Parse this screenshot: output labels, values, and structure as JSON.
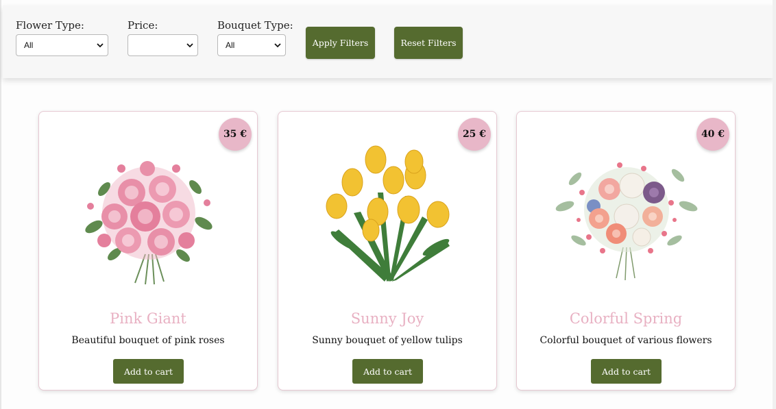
{
  "filters": {
    "flower_type": {
      "label": "Flower Type:",
      "selected": "All"
    },
    "price": {
      "label": "Price:",
      "selected": ""
    },
    "bouquet_type": {
      "label": "Bouquet Type:",
      "selected": "All"
    },
    "apply_label": "Apply Filters",
    "reset_label": "Reset Filters"
  },
  "products": [
    {
      "name": "Pink Giant",
      "description": "Beautiful bouquet of pink roses",
      "price": "35 €",
      "cart_label": "Add to cart",
      "image_icon": "pink-roses-bouquet"
    },
    {
      "name": "Sunny Joy",
      "description": "Sunny bouquet of yellow tulips",
      "price": "25 €",
      "cart_label": "Add to cart",
      "image_icon": "yellow-tulips-bouquet"
    },
    {
      "name": "Colorful Spring",
      "description": "Colorful bouquet of various flowers",
      "price": "40 €",
      "cart_label": "Add to cart",
      "image_icon": "mixed-flowers-bouquet"
    }
  ],
  "colors": {
    "accent_green": "#556b2f",
    "badge_pink": "#e8b7c8",
    "title_pink": "#e8b0c2",
    "card_border": "#e6c8d2"
  }
}
